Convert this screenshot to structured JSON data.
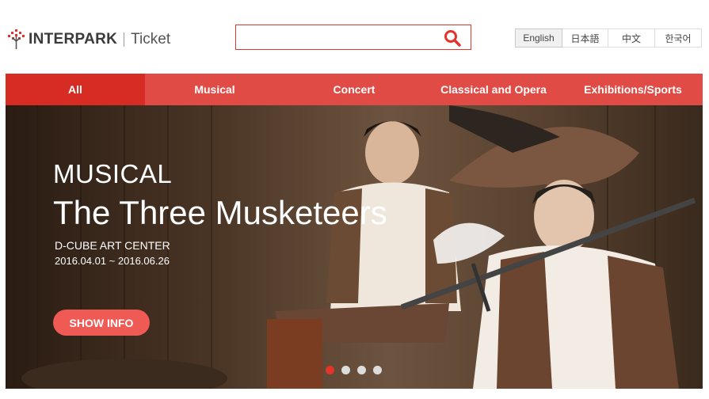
{
  "header": {
    "brand": "INTERPARK",
    "sub_brand": "Ticket",
    "search_placeholder": "",
    "brand_color": "#e4332a"
  },
  "languages": [
    {
      "label": "English",
      "active": true
    },
    {
      "label": "日本語",
      "active": false
    },
    {
      "label": "中文",
      "active": false
    },
    {
      "label": "한국어",
      "active": false
    }
  ],
  "nav": {
    "items": [
      {
        "label": "All",
        "active": true
      },
      {
        "label": "Musical",
        "active": false
      },
      {
        "label": "Concert",
        "active": false
      },
      {
        "label": "Classical and Opera",
        "active": false
      },
      {
        "label": "Exhibitions/Sports",
        "active": false
      }
    ]
  },
  "hero": {
    "category": "MUSICAL",
    "title": "The Three Musketeers",
    "venue": "D-CUBE ART CENTER",
    "dates": "2016.04.01 ~ 2016.06.26",
    "button_label": "SHOW INFO",
    "slide_count": 4,
    "active_slide": 1
  },
  "icons": {
    "logo": "tree-logo-icon",
    "search": "search-icon"
  }
}
